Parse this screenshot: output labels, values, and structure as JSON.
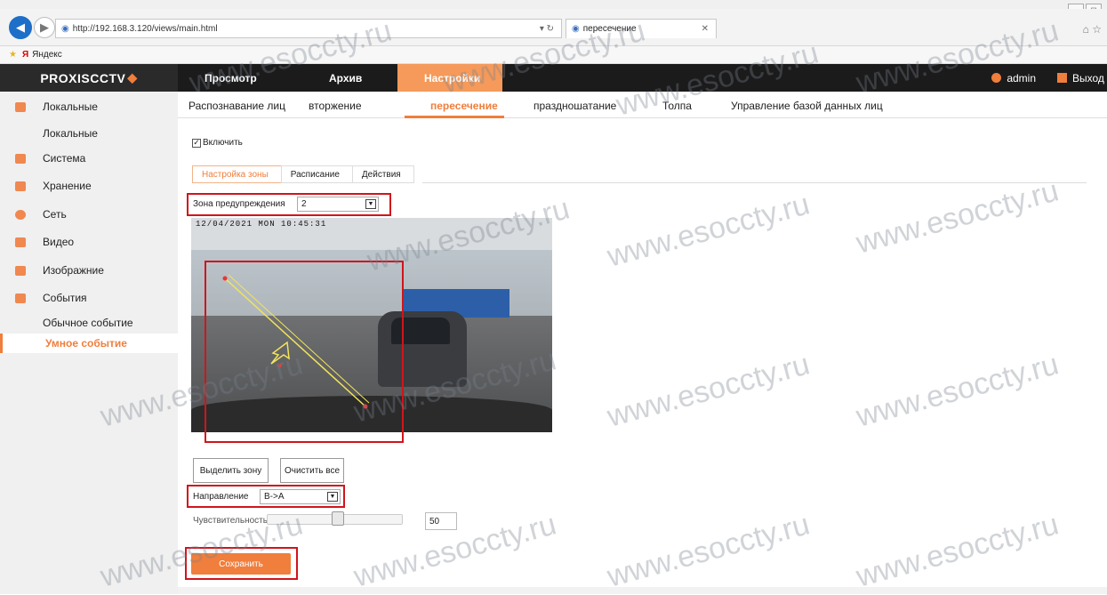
{
  "browser": {
    "address": "http://192.168.3.120/views/main.html",
    "address_host": "192.168.3.120",
    "tab_title": "пересечение",
    "favorites": "Яндекс"
  },
  "app": {
    "logo": "PROXISCCTV",
    "nav": {
      "view": "Просмотр",
      "archive": "Архив",
      "settings": "Настройки"
    },
    "user": "admin",
    "logout": "Выход"
  },
  "sidebar": {
    "items": [
      "Локальные",
      "Система",
      "Хранение",
      "Сеть",
      "Видео",
      "Изображние",
      "События"
    ],
    "sub_local": "Локальные",
    "sub_events": [
      "Обычное событие",
      "Умное событие"
    ]
  },
  "subtabs": [
    "Распознавание лиц",
    "вторжение",
    "пересечение",
    "праздношатание",
    "Толпа",
    "Управление базой данных лиц"
  ],
  "content": {
    "enable_label": "Включить",
    "steps": [
      "Настройка зоны",
      "Расписание",
      "Действия"
    ],
    "zone_label": "Зона предупреждения",
    "zone_value": "2",
    "osd": "12/04/2021 MON 10:45:31",
    "draw_zone_btn": "Выделить зону",
    "clear_btn": "Очистить все",
    "direction_label": "Направление",
    "direction_value": "B->A",
    "sensitivity_label": "Чувствительность",
    "sensitivity_value": "50",
    "save_btn": "Сохранить"
  },
  "watermark": "www.esoccty.ru",
  "colors": {
    "accent": "#f07e3c",
    "highlight": "#d0151c",
    "nav_bg": "#1b1b1b"
  }
}
